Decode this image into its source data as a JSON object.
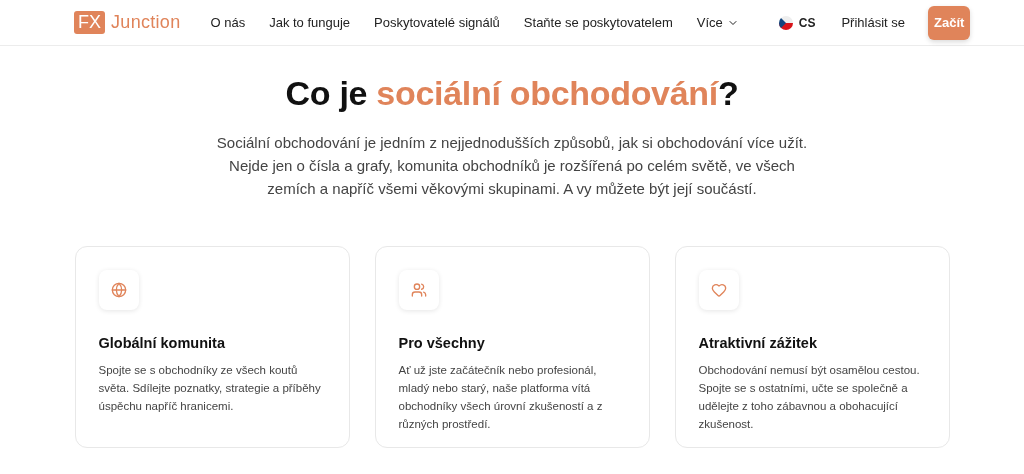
{
  "logo": {
    "badge": "FX",
    "name": "Junction"
  },
  "nav": [
    {
      "label": "O nás",
      "dropdown": false
    },
    {
      "label": "Jak to funguje",
      "dropdown": false
    },
    {
      "label": "Poskytovatelé signálů",
      "dropdown": false
    },
    {
      "label": "Staňte se poskytovatelem",
      "dropdown": false
    },
    {
      "label": "Více",
      "dropdown": true
    }
  ],
  "language": {
    "code": "CS"
  },
  "login": "Přihlásit se",
  "cta": "Začít",
  "heading": [
    {
      "text": "Co je ",
      "accent": false
    },
    {
      "text": "sociální obchodování",
      "accent": true
    },
    {
      "text": "?",
      "accent": false
    }
  ],
  "intro": "Sociální obchodování je jedním z nejjednodušších způsobů, jak si obchodování více užít. Nejde jen o čísla a grafy, komunita obchodníků je rozšířená po celém světě, ve všech zemích a napříč všemi věkovými skupinami. A vy můžete být její součástí.",
  "cards": [
    {
      "kind": "globe",
      "title": "Globální komunita",
      "text": "Spojte se s obchodníky ze všech koutů světa. Sdílejte poznatky, strategie a příběhy úspěchu napříč hranicemi."
    },
    {
      "kind": "users",
      "title": "Pro všechny",
      "text": "Ať už jste začátečník nebo profesionál, mladý nebo starý, naše platforma vítá obchodníky všech úrovní zkušeností a z různých prostředí."
    },
    {
      "kind": "heart",
      "title": "Atraktivní zážitek",
      "text": "Obchodování nemusí být osamělou cestou. Spojte se s ostatními, učte se společně a udělejte z toho zábavnou a obohacující zkušenost."
    }
  ]
}
